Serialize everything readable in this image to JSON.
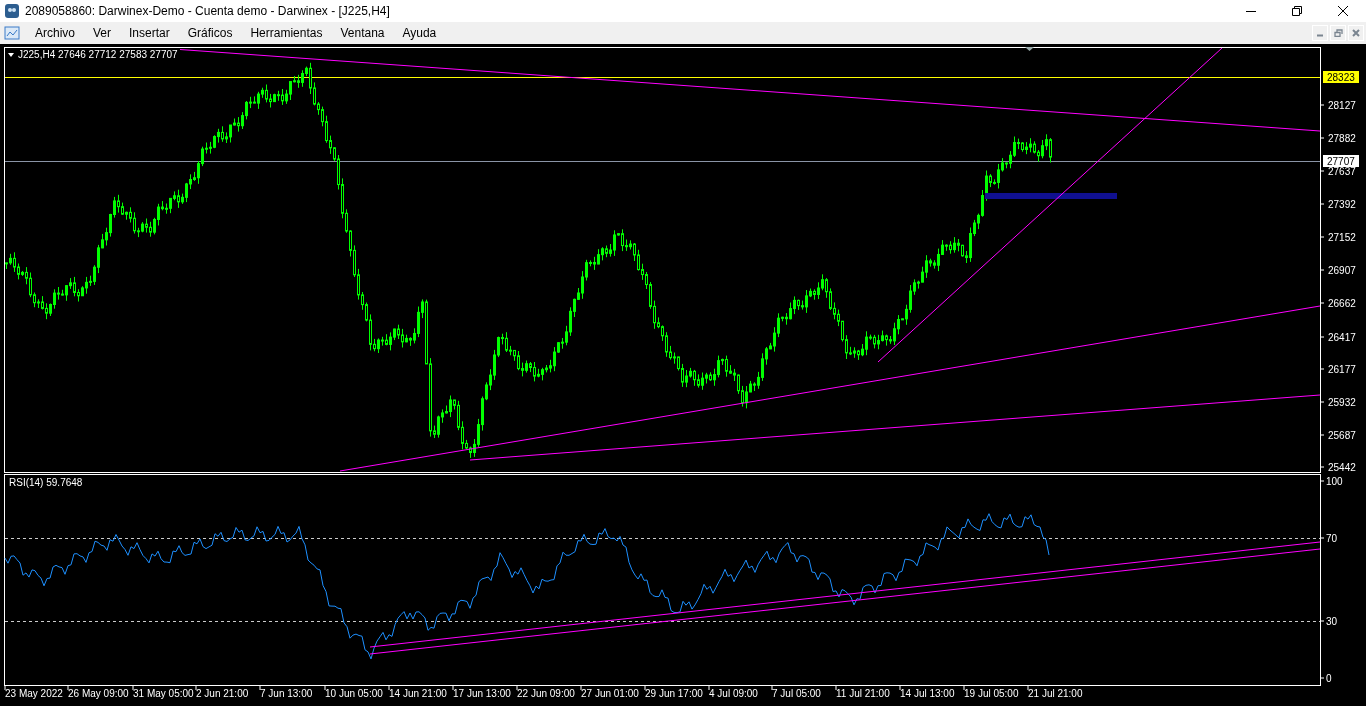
{
  "window": {
    "title": "2089058860: Darwinex-Demo - Cuenta demo - Darwinex - [J225,H4]"
  },
  "menu": [
    "Archivo",
    "Ver",
    "Insertar",
    "Gráficos",
    "Herramientas",
    "Ventana",
    "Ayuda"
  ],
  "chart": {
    "legend": "J225,H4  27646 27712 27583 27707",
    "price_axis": [
      "28127",
      "27882",
      "27637",
      "27392",
      "27152",
      "26907",
      "26662",
      "26417",
      "26177",
      "25932",
      "25687",
      "25442"
    ],
    "price_badges": [
      {
        "text": "28323",
        "color": "#ffff00"
      },
      {
        "text": "27707",
        "color": "#ffffff"
      }
    ]
  },
  "rsi": {
    "legend": "RSI(14) 59.7648",
    "axis": [
      "100",
      "70",
      "30",
      "0"
    ]
  },
  "time_axis": [
    "23 May 2022",
    "26 May 09:00",
    "31 May 05:00",
    "2 Jun 21:00",
    "7 Jun 13:00",
    "10 Jun 05:00",
    "14 Jun 21:00",
    "17 Jun 13:00",
    "22 Jun 09:00",
    "27 Jun 01:00",
    "29 Jun 17:00",
    "4 Jul 09:00",
    "7 Jul 05:00",
    "11 Jul 21:00",
    "14 Jul 13:00",
    "19 Jul 05:00",
    "21 Jul 21:00"
  ]
}
